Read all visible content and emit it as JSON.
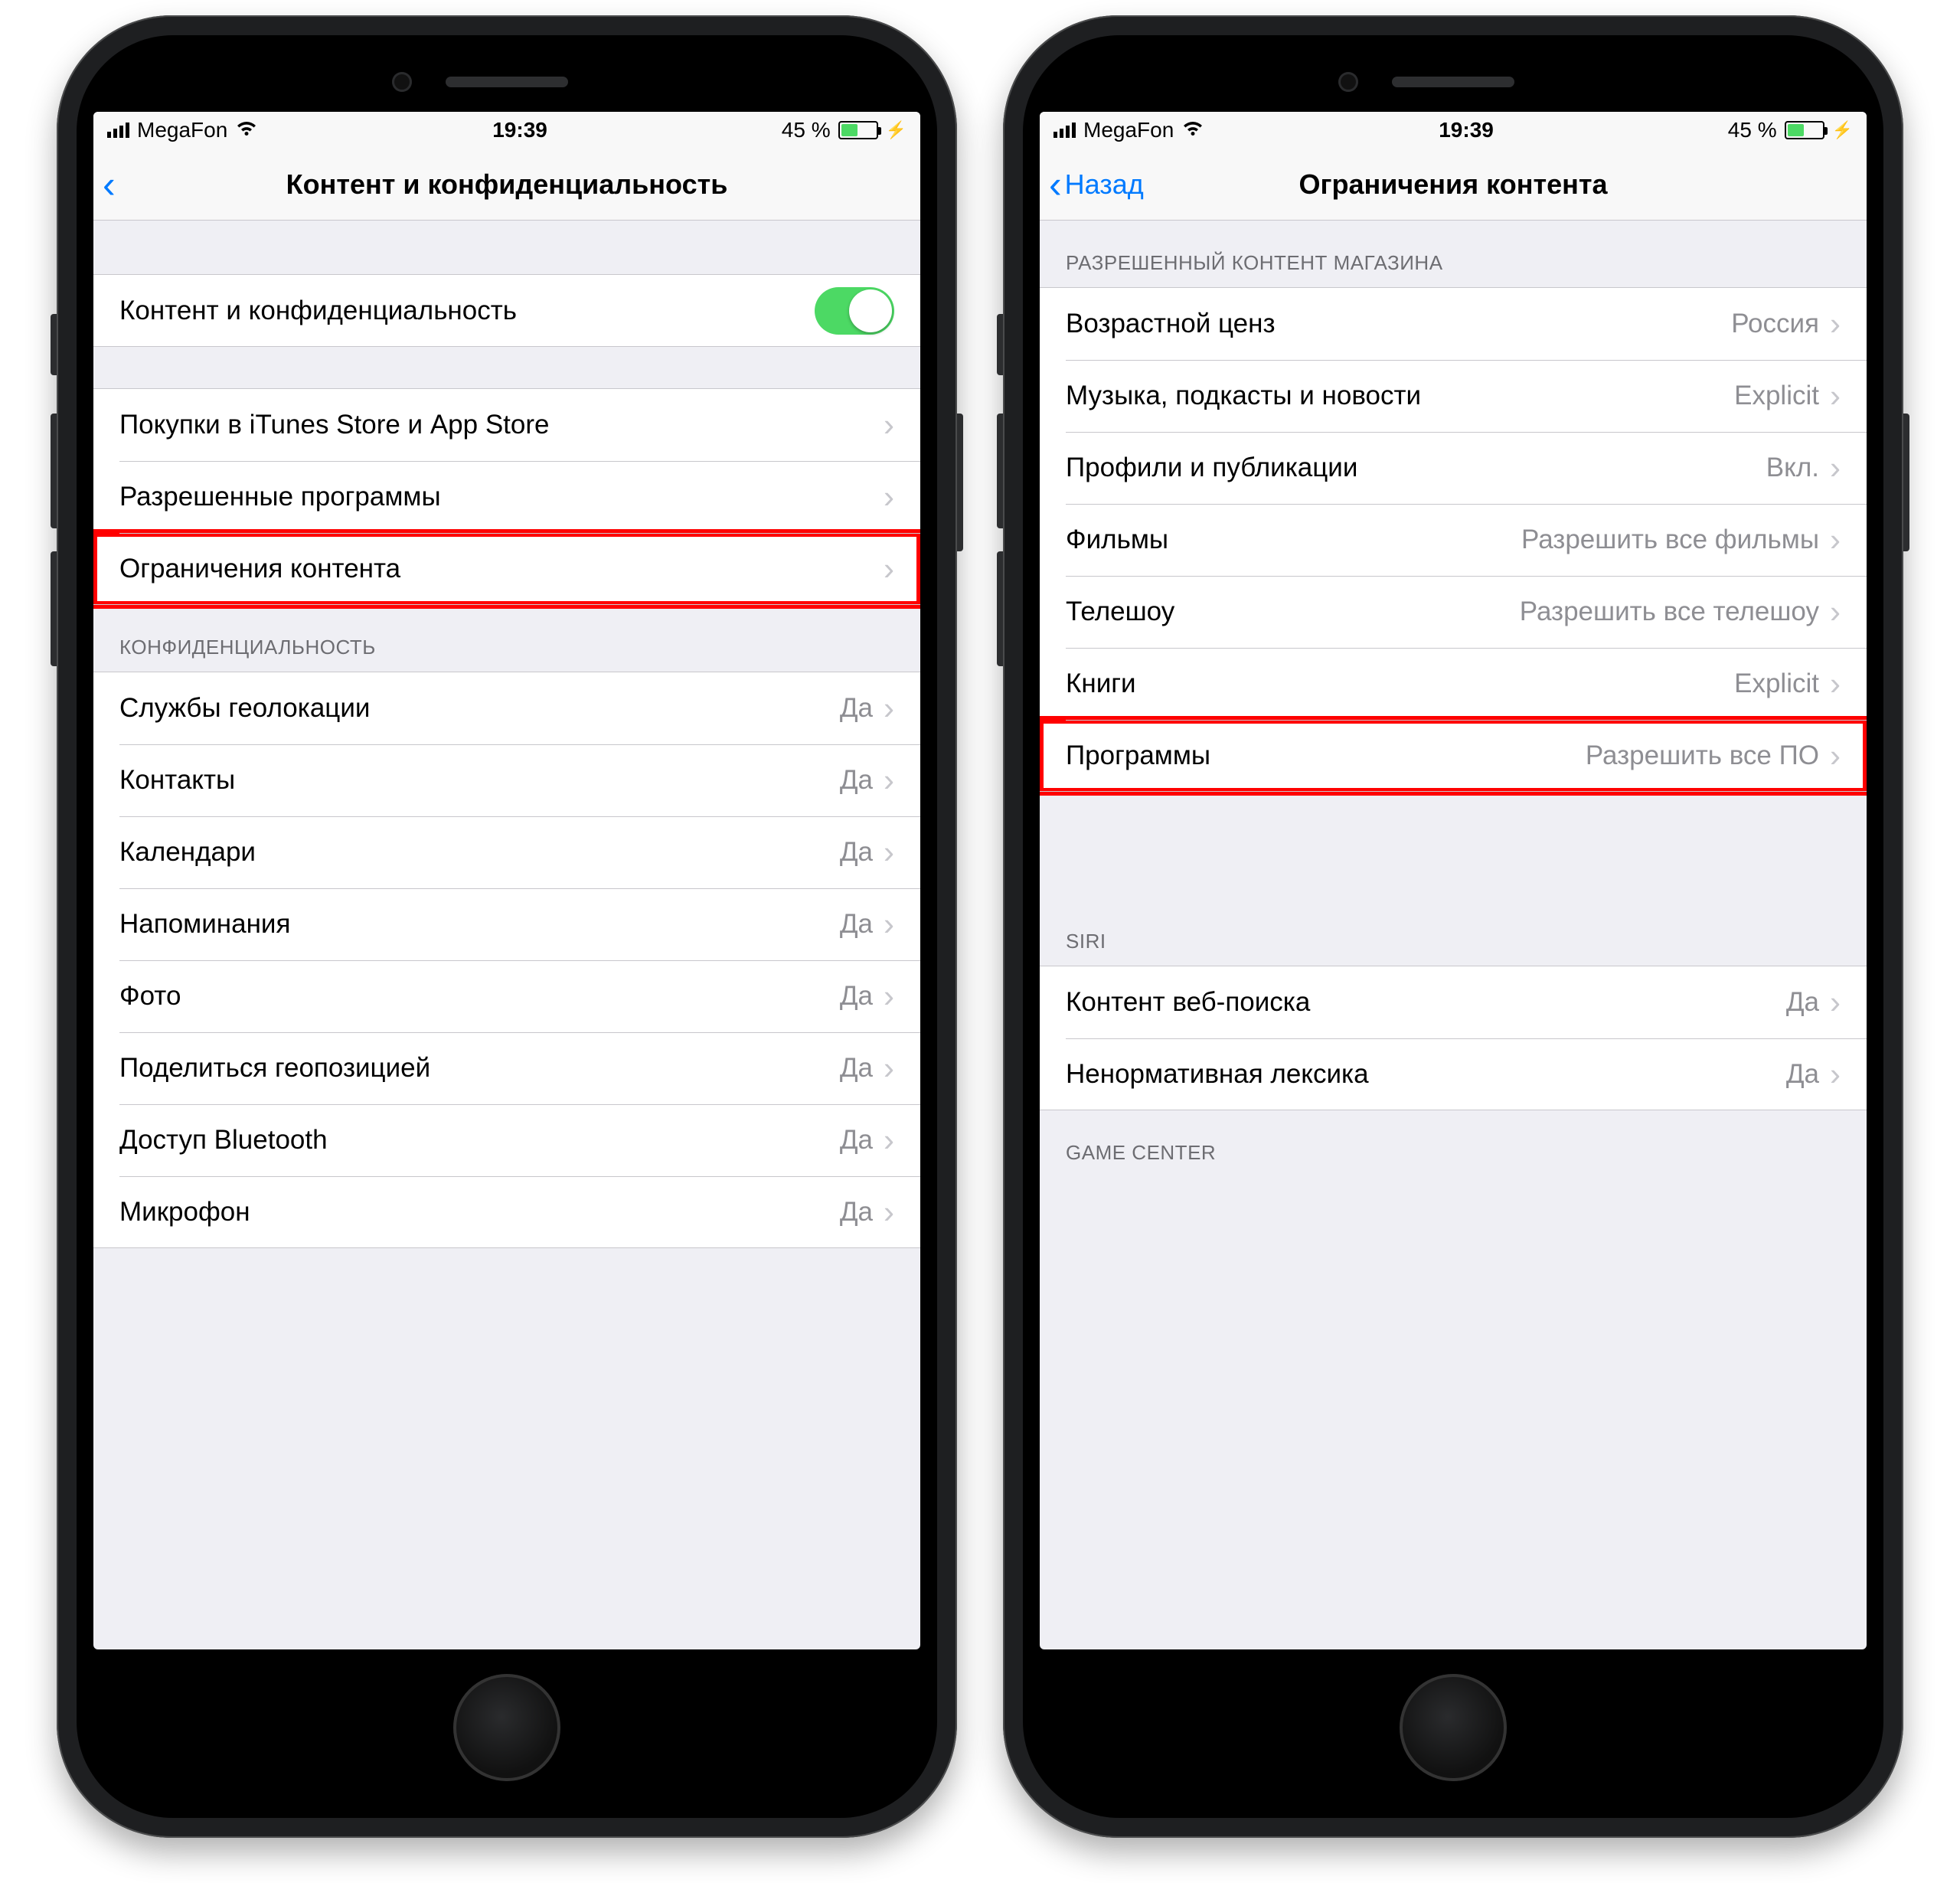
{
  "status": {
    "carrier": "MegaFon",
    "time": "19:39",
    "battery_pct": "45 %"
  },
  "left": {
    "title": "Контент и конфиденциальность",
    "toggle_label": "Контент и конфиденциальность",
    "group1": {
      "itunes": "Покупки в iTunes Store и App Store",
      "allowed_apps": "Разрешенные программы",
      "content_restrictions": "Ограничения контента"
    },
    "privacy_header": "КОНФИДЕНЦИАЛЬНОСТЬ",
    "privacy": [
      {
        "label": "Службы геолокации",
        "value": "Да"
      },
      {
        "label": "Контакты",
        "value": "Да"
      },
      {
        "label": "Календари",
        "value": "Да"
      },
      {
        "label": "Напоминания",
        "value": "Да"
      },
      {
        "label": "Фото",
        "value": "Да"
      },
      {
        "label": "Поделиться геопозицией",
        "value": "Да"
      },
      {
        "label": "Доступ Bluetooth",
        "value": "Да"
      },
      {
        "label": "Микрофон",
        "value": "Да"
      }
    ]
  },
  "right": {
    "back_label": "Назад",
    "title": "Ограничения контента",
    "store_header": "РАЗРЕШЕННЫЙ КОНТЕНТ МАГАЗИНА",
    "store": [
      {
        "label": "Возрастной ценз",
        "value": "Россия"
      },
      {
        "label": "Музыка, подкасты и новости",
        "value": "Explicit"
      },
      {
        "label": "Профили и публикации",
        "value": "Вкл."
      },
      {
        "label": "Фильмы",
        "value": "Разрешить все фильмы"
      },
      {
        "label": "Телешоу",
        "value": "Разрешить все телешоу"
      },
      {
        "label": "Книги",
        "value": "Explicit"
      },
      {
        "label": "Программы",
        "value": "Разрешить все ПО"
      }
    ],
    "siri_header": "SIRI",
    "siri": [
      {
        "label": "Контент веб-поиска",
        "value": "Да"
      },
      {
        "label": "Ненормативная лексика",
        "value": "Да"
      }
    ],
    "gc_header": "GAME CENTER"
  }
}
